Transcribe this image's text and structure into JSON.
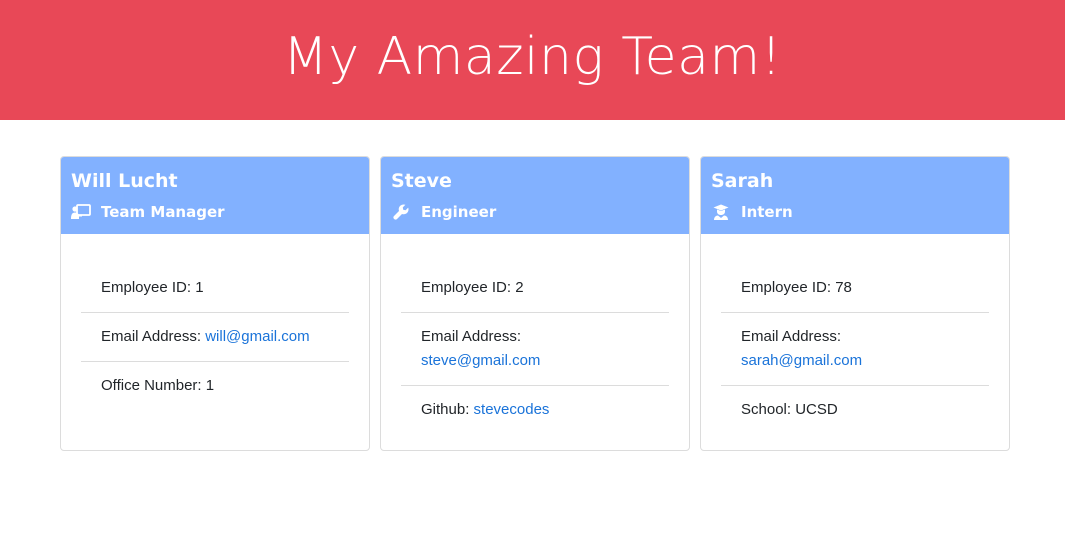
{
  "header": {
    "title": "My Amazing Team!"
  },
  "colors": {
    "header_bg": "#e84857",
    "card_header_bg": "#82b1ff",
    "link": "#1a73d9"
  },
  "cards": [
    {
      "name": "Will Lucht",
      "role": "Team Manager",
      "role_icon": "presentation-icon",
      "id_label": "Employee ID: ",
      "id_value": "1",
      "email_label": "Email Address: ",
      "email_value": "will@gmail.com",
      "extra_label": "Office Number: ",
      "extra_value": "1"
    },
    {
      "name": "Steve",
      "role": "Engineer",
      "role_icon": "wrench-icon",
      "id_label": "Employee ID: ",
      "id_value": "2",
      "email_label": "Email Address: ",
      "email_value": "steve@gmail.com",
      "extra_label": "Github: ",
      "extra_value": "stevecodes"
    },
    {
      "name": "Sarah",
      "role": "Intern",
      "role_icon": "graduate-icon",
      "id_label": "Employee ID: ",
      "id_value": "78",
      "email_label": "Email Address: ",
      "email_value": "sarah@gmail.com",
      "extra_label": "School: ",
      "extra_value": "UCSD"
    }
  ]
}
